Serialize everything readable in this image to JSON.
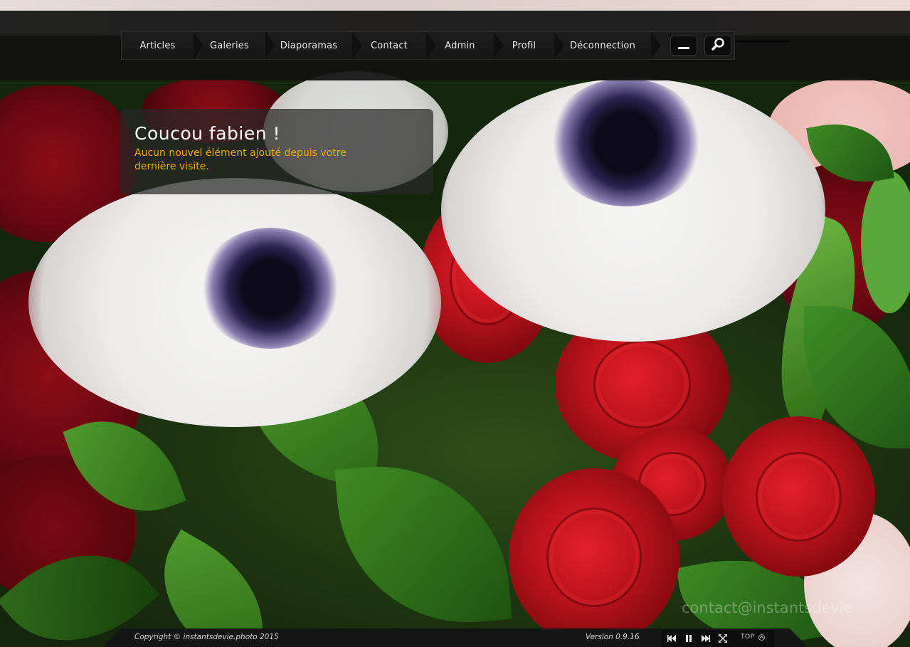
{
  "nav": {
    "items": [
      "Articles",
      "Galeries",
      "Diaporamas",
      "Contact",
      "Admin",
      "Profil",
      "Déconnection"
    ],
    "icons": [
      "minimize-icon",
      "search-icon"
    ]
  },
  "greeting": {
    "title": "Coucou fabien !",
    "message": "Aucun nouvel élément ajouté depuis votre dernière visite."
  },
  "watermark": "contact@instantsdevie",
  "footer": {
    "copyright": "Copyright © instantsdevie.photo 2015",
    "version": "Version 0.9.16",
    "controls": [
      "previous-icon",
      "pause-icon",
      "next-icon",
      "fullscreen-icon"
    ],
    "top_label": "TOP"
  },
  "colors": {
    "accent": "#f0a800",
    "bar": "#121212",
    "text": "#e8e8e8"
  }
}
